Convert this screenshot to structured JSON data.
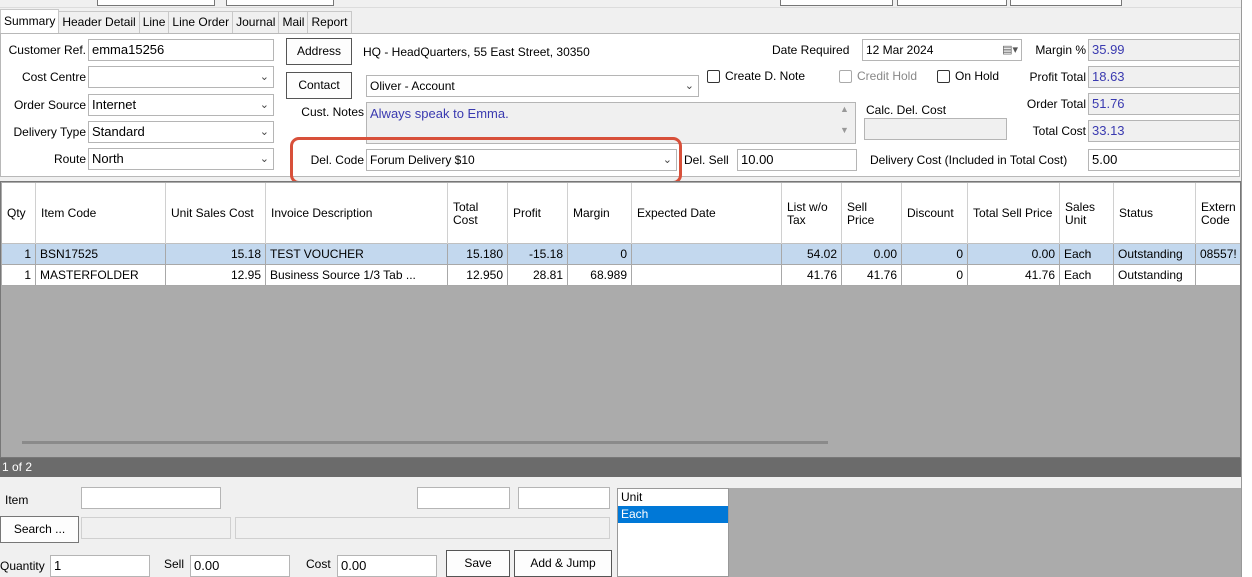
{
  "tabs": [
    "Summary",
    "Header Detail",
    "Line",
    "Line Order",
    "Journal",
    "Mail",
    "Report"
  ],
  "customer_ref": {
    "label": "Customer Ref.",
    "value": "emma15256"
  },
  "cost_centre": {
    "label": "Cost Centre",
    "value": ""
  },
  "order_source": {
    "label": "Order Source",
    "value": "Internet"
  },
  "delivery_type": {
    "label": "Delivery Type",
    "value": "Standard"
  },
  "route": {
    "label": "Route",
    "value": "North"
  },
  "address": {
    "button": "Address",
    "value": "HQ - HeadQuarters, 55 East Street, 30350"
  },
  "contact": {
    "button": "Contact",
    "value": "Oliver - Account"
  },
  "cust_notes": {
    "label": "Cust. Notes",
    "value": "Always speak to Emma."
  },
  "del_code": {
    "label": "Del. Code",
    "value": "Forum Delivery $10"
  },
  "del_sell": {
    "label": "Del. Sell",
    "value": "10.00"
  },
  "create_d_note": "Create D. Note",
  "credit_hold": "Credit Hold",
  "on_hold": "On Hold",
  "date_required": {
    "label": "Date Required",
    "value": "12 Mar 2024"
  },
  "calc_del_cost": {
    "label": "Calc. Del. Cost",
    "value": ""
  },
  "delivery_cost": {
    "label": "Delivery Cost (Included in Total Cost)",
    "value": "5.00"
  },
  "margin": {
    "label": "Margin %",
    "value": "35.99"
  },
  "profit_total": {
    "label": "Profit Total",
    "value": "18.63"
  },
  "order_total": {
    "label": "Order Total",
    "value": "51.76"
  },
  "total_cost": {
    "label": "Total Cost",
    "value": "33.13"
  },
  "columns": {
    "qty": "Qty",
    "item_code": "Item Code",
    "unit_sales_cost": "Unit Sales Cost",
    "invoice_description": "Invoice Description",
    "total_cost": "Total Cost",
    "profit": "Profit",
    "margin": "Margin",
    "expected_date": "Expected Date",
    "list_wo_tax": "List w/o Tax",
    "sell_price": "Sell Price",
    "discount": "Discount",
    "total_sell_price": "Total Sell Price",
    "sales_unit": "Sales Unit",
    "status": "Status",
    "external_code": "Extern Code"
  },
  "rows": [
    {
      "qty": "1",
      "item_code": "BSN17525",
      "unit_sales_cost": "15.18",
      "invoice_description": "TEST VOUCHER",
      "total_cost": "15.180",
      "profit": "-15.18",
      "margin": "0",
      "expected_date": "",
      "list_wo_tax": "54.02",
      "sell_price": "0.00",
      "discount": "0",
      "total_sell_price": "0.00",
      "sales_unit": "Each",
      "status": "Outstanding",
      "external_code": "08557!"
    },
    {
      "qty": "1",
      "item_code": "MASTERFOLDER",
      "unit_sales_cost": "12.95",
      "invoice_description": "Business Source 1/3 Tab ...",
      "total_cost": "12.950",
      "profit": "28.81",
      "margin": "68.989",
      "expected_date": "",
      "list_wo_tax": "41.76",
      "sell_price": "41.76",
      "discount": "0",
      "total_sell_price": "41.76",
      "sales_unit": "Each",
      "status": "Outstanding",
      "external_code": ""
    }
  ],
  "pager": "1 of 2",
  "bottom": {
    "item_label": "Item",
    "search_button": "Search ...",
    "quantity_label": "Quantity",
    "quantity_value": "1",
    "sell_label": "Sell",
    "sell_value": "0.00",
    "cost_label": "Cost",
    "cost_value": "0.00",
    "save_button": "Save",
    "add_jump_button": "Add & Jump"
  },
  "unit_list": {
    "header": "Unit",
    "items": [
      "Each"
    ]
  },
  "colors": {
    "selected_row": "#c3d8ee",
    "highlight": "#d8503a",
    "unit_selected": "#0078d7",
    "value_blue": "#3a3ab0"
  }
}
